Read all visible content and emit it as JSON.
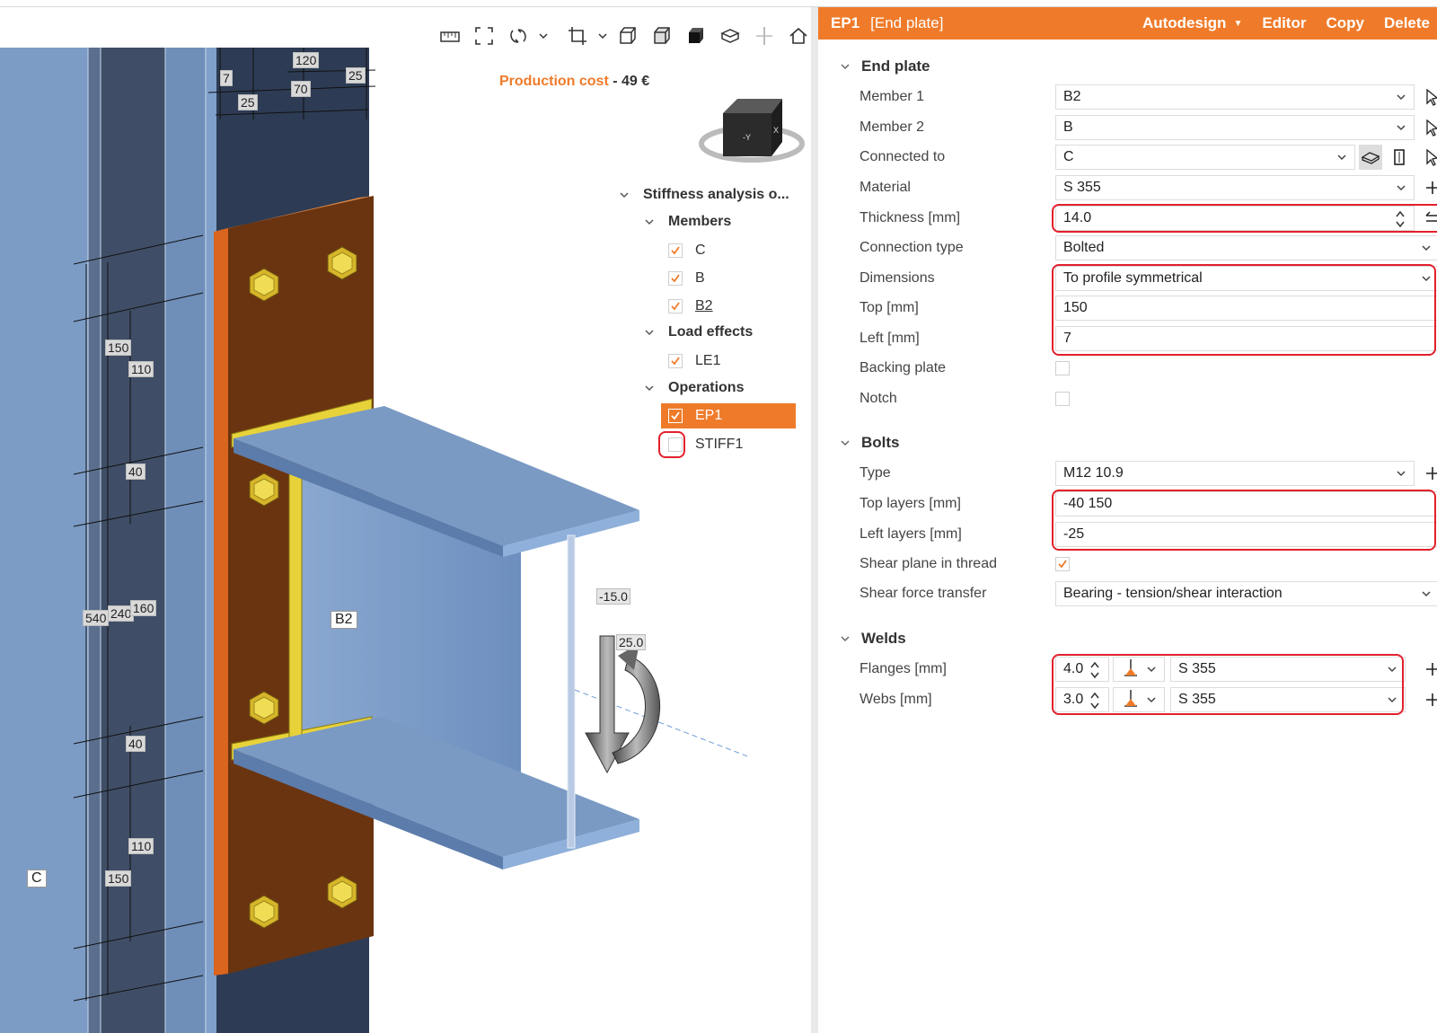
{
  "toolbar": {
    "icons": [
      "ruler-icon",
      "fit-view-icon",
      "rotate-icon",
      "chevron-down-icon",
      "crop-icon",
      "chevron-down-icon",
      "wireframe-cube-icon",
      "transparent-cube-icon",
      "solid-cube-icon",
      "section-view-icon",
      "mirror-icon",
      "home-view-icon"
    ]
  },
  "production_cost": {
    "label": "Production cost",
    "separator": " - ",
    "value": "49 €"
  },
  "tree": {
    "root": "Stiffness analysis o...",
    "members_label": "Members",
    "members": [
      "C",
      "B",
      "B2"
    ],
    "load_effects_label": "Load effects",
    "load_effects": [
      "LE1"
    ],
    "operations_label": "Operations",
    "operations": [
      {
        "label": "EP1",
        "checked": true,
        "selected": true
      },
      {
        "label": "STIFF1",
        "checked": false,
        "selected": false
      }
    ]
  },
  "scene_labels": {
    "dims_top": [
      "120",
      "7",
      "25",
      "70",
      "25"
    ],
    "dims_left": [
      "150",
      "110",
      "40",
      "540",
      "240",
      "160",
      "40",
      "110",
      "150"
    ],
    "member_c": "C",
    "member_b2": "B2",
    "load_moment": "-15.0",
    "load_force": "25.0"
  },
  "panel": {
    "id": "EP1",
    "title": "[End plate]",
    "actions": {
      "autodesign": "Autodesign",
      "editor": "Editor",
      "copy": "Copy",
      "delete": "Delete"
    },
    "end_plate": {
      "section": "End plate",
      "member1": {
        "label": "Member 1",
        "value": "B2"
      },
      "member2": {
        "label": "Member 2",
        "value": "B"
      },
      "connected_to": {
        "label": "Connected to",
        "value": "C"
      },
      "material": {
        "label": "Material",
        "value": "S 355"
      },
      "thickness": {
        "label": "Thickness [mm]",
        "value": "14.0"
      },
      "connection_type": {
        "label": "Connection type",
        "value": "Bolted"
      },
      "dimensions": {
        "label": "Dimensions",
        "value": "To profile symmetrical"
      },
      "top": {
        "label": "Top [mm]",
        "value": "150"
      },
      "left": {
        "label": "Left [mm]",
        "value": "7"
      },
      "backing_plate": {
        "label": "Backing plate",
        "checked": false
      },
      "notch": {
        "label": "Notch",
        "checked": false
      }
    },
    "bolts": {
      "section": "Bolts",
      "type": {
        "label": "Type",
        "value": "M12 10.9"
      },
      "top_layers": {
        "label": "Top layers [mm]",
        "value": "-40 150"
      },
      "left_layers": {
        "label": "Left layers [mm]",
        "value": "-25"
      },
      "shear_plane": {
        "label": "Shear plane in thread",
        "checked": true
      },
      "shear_transfer": {
        "label": "Shear force transfer",
        "value": "Bearing - tension/shear interaction"
      }
    },
    "welds": {
      "section": "Welds",
      "flanges": {
        "label": "Flanges [mm]",
        "size": "4.0",
        "material": "S 355"
      },
      "webs": {
        "label": "Webs [mm]",
        "size": "3.0",
        "material": "S 355"
      }
    }
  },
  "colors": {
    "accent": "#ef7b2a",
    "highlight": "#e3202c",
    "plate": "#6b3410",
    "steel": "#7f9fc7",
    "weld": "#e8d23a"
  }
}
